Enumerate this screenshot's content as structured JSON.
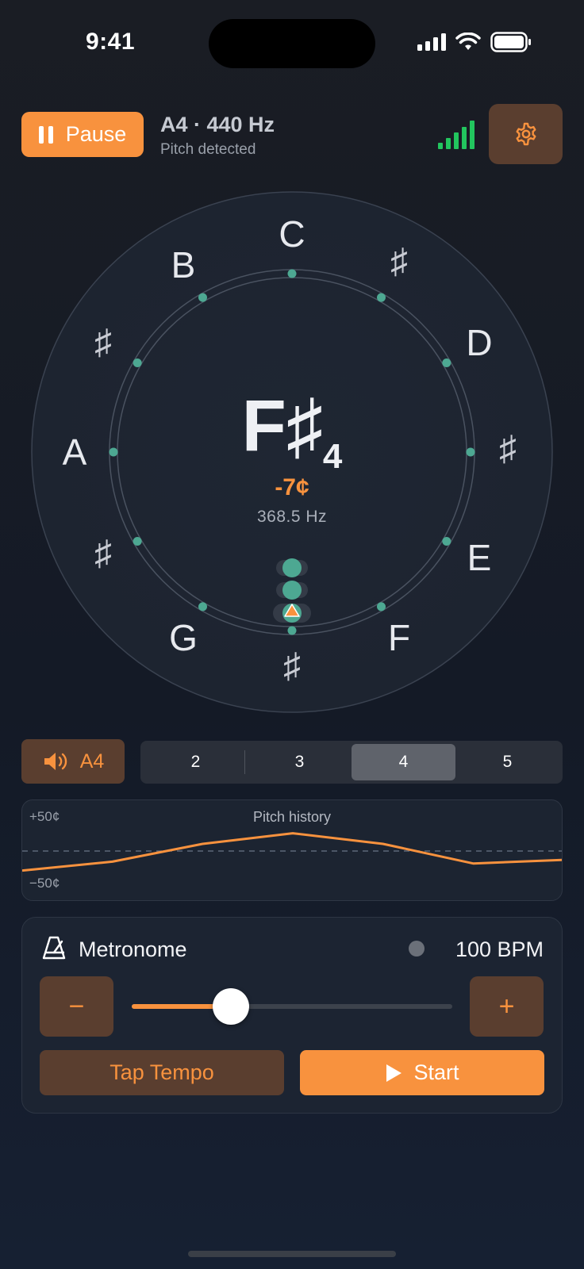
{
  "status_bar": {
    "time": "9:41"
  },
  "header": {
    "pause_label": "Pause",
    "reference": "A4 · 440 Hz",
    "status": "Pitch detected",
    "signal_level": 5,
    "signal_max": 5
  },
  "dial": {
    "notes": {
      "C": "C",
      "Cs": "♯",
      "D": "D",
      "Ds": "♯",
      "E": "E",
      "F": "F",
      "Fs": "♯",
      "G": "G",
      "Gs": "♯",
      "A": "A",
      "As": "♯",
      "B": "B"
    },
    "current_note": "F♯",
    "current_octave": "4",
    "cents": "-7¢",
    "frequency": "368.5 Hz"
  },
  "controls": {
    "reference_tone_label": "A4",
    "octaves": [
      "2",
      "3",
      "4",
      "5"
    ],
    "selected_octave": "4"
  },
  "history": {
    "title": "Pitch history",
    "top_label": "+50¢",
    "bottom_label": "−50¢",
    "cents_values": [
      -22,
      -12,
      8,
      20,
      8,
      -14,
      -10
    ]
  },
  "metronome": {
    "title": "Metronome",
    "bpm": "100 BPM",
    "minus_label": "−",
    "plus_label": "+",
    "tempo_fraction": 0.31,
    "tap_label": "Tap Tempo",
    "start_label": "Start"
  },
  "colors": {
    "accent": "#f8923e",
    "teal": "#4da892",
    "signal": "#22c55e"
  }
}
